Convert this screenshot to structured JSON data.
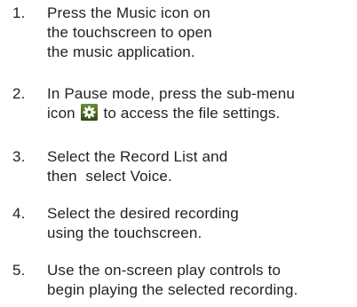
{
  "steps": [
    {
      "number": "1.",
      "lines": [
        "Press the Music icon on",
        "the touchscreen to open",
        "the music application."
      ]
    },
    {
      "number": "2.",
      "line1": "In Pause mode, press the sub-menu",
      "line2_before": "icon",
      "line2_after": "to access the file settings.",
      "icon": "settings-gear-icon"
    },
    {
      "number": "3.",
      "lines": [
        "Select the Record List and",
        "then  select Voice."
      ]
    },
    {
      "number": "4.",
      "lines": [
        "Select the desired recording",
        "using the touchscreen."
      ]
    },
    {
      "number": "5.",
      "lines": [
        "Use the on-screen play controls to",
        "begin playing the selected recording."
      ]
    }
  ],
  "colors": {
    "text": "#231f20",
    "icon_bg_top": "#6a8f3a",
    "icon_bg_bottom": "#2f4a17",
    "icon_fg": "#ffffff"
  }
}
